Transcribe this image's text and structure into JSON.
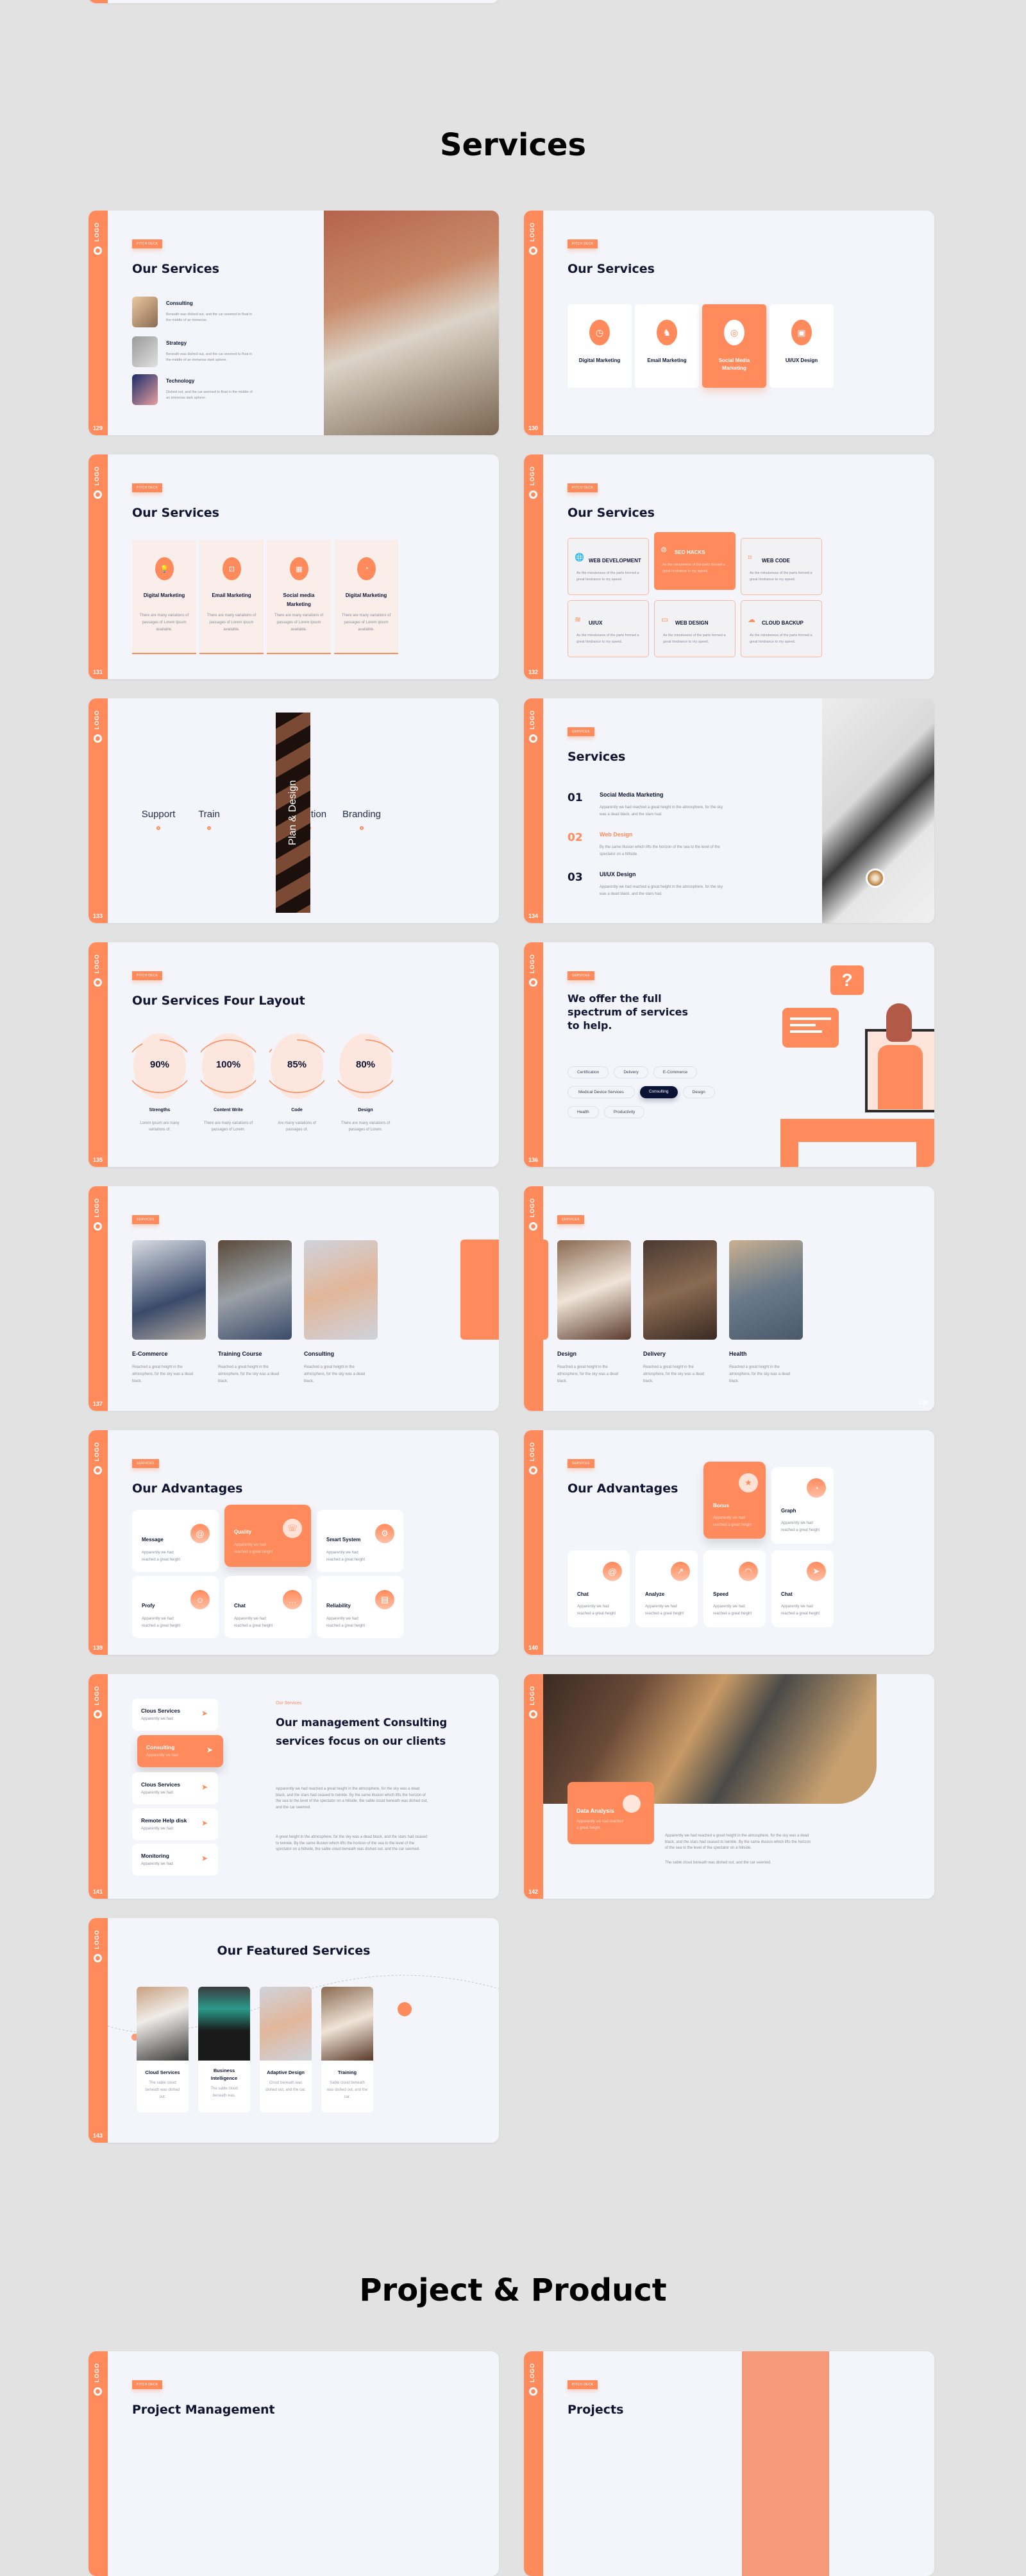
{
  "sections": {
    "services": "Services",
    "project": "Project & Product"
  },
  "common": {
    "logo": "LOGO",
    "tag_pitch": "PITCH DECK",
    "tag_services": "SERVICES"
  },
  "s129": {
    "page": "129",
    "title": "Our Services",
    "items": [
      {
        "title": "Consulting",
        "text": "Beneath was dished out, and the car seemed to float in the middle of an immense."
      },
      {
        "title": "Strategy",
        "text": "Beneath was dished out, and the car seemed to float in the middle of an immense dark sphere."
      },
      {
        "title": "Technology",
        "text": "Dished out, and the car seemed to float in the middle of an immense dark sphere."
      }
    ]
  },
  "s130": {
    "page": "130",
    "title": "Our Services",
    "cards": [
      "Digital Marketing",
      "Email Marketing",
      "Social Media Marketing",
      "UI/UX Design"
    ],
    "active": 2
  },
  "s131": {
    "page": "131",
    "title": "Our Services",
    "cards": [
      {
        "title": "Digital Marketing",
        "text": "There are many variations of passages of Lorem Ipsum available."
      },
      {
        "title": "Email Marketing",
        "text": "There are many variations of passages of Lorem Ipsum available."
      },
      {
        "title": "Social media Marketing",
        "text": "There are many variations of passages of Lorem Ipsum available."
      },
      {
        "title": "Digital Marketing",
        "text": "There are many variations of passages of Lorem Ipsum available."
      }
    ]
  },
  "s132": {
    "page": "132",
    "title": "Our Services",
    "cards": [
      {
        "title": "WEB DEVELOPMENT",
        "text": "As the minuteness of the parts formed a great hindrance to my speed."
      },
      {
        "title": "SEO HACKS",
        "text": "As the minuteness of the parts formed a great hindrance to my speed."
      },
      {
        "title": "WEB CODE",
        "text": "As the minuteness of the parts formed a great hindrance to my speed."
      },
      {
        "title": "UI/UX",
        "text": "As the minuteness of the parts formed a great hindrance to my speed."
      },
      {
        "title": "WEB DESIGN",
        "text": "As the minuteness of the parts formed a great hindrance to my speed."
      },
      {
        "title": "CLOUD BACKUP",
        "text": "As the minuteness of the parts formed a great hindrance to my speed."
      }
    ]
  },
  "s133": {
    "page": "133",
    "items": [
      "Support",
      "Train",
      "Solution",
      "Branding"
    ],
    "center": "Plan & Design"
  },
  "s134": {
    "page": "134",
    "title": "Services",
    "items": [
      {
        "num": "01",
        "title": "Social Media Marketing",
        "text": "Apparently we had reached a great height in the atmosphere, for the sky was a dead black, and the stars had."
      },
      {
        "num": "02",
        "title": "Web Design",
        "text": "By the same illusion which lifts the horizon of the sea to the level of the spectator on a hillside."
      },
      {
        "num": "03",
        "title": "UI/UX Design",
        "text": "Apparently we had reached a great height in the atmosphere, for the sky was a dead black, and the stars had."
      }
    ]
  },
  "s135": {
    "page": "135",
    "title": "Our Services Four Layout",
    "items": [
      {
        "value": 90,
        "label": "Strengths",
        "text": "Lorem ipsum are many variations of."
      },
      {
        "value": 100,
        "label": "Content Write",
        "text": "There are many variations of passages of Lorem."
      },
      {
        "value": 85,
        "label": "Code",
        "text": "Are many variations of passages of."
      },
      {
        "value": 80,
        "label": "Design",
        "text": "There are many variations of passages of Lorem."
      }
    ]
  },
  "s136": {
    "page": "136",
    "title": "We offer the full spectrum of services to help.",
    "chips": [
      "Certification",
      "Delivery",
      "E-Commerce",
      "Medical Device Services",
      "Consulting",
      "Design",
      "Health",
      "Productivity"
    ],
    "active": "Consulting"
  },
  "s137": {
    "page": "137",
    "items": [
      {
        "title": "E-Commerce",
        "text": "Reached a great height in the atmosphere, for the sky was a dead black."
      },
      {
        "title": "Training Course",
        "text": "Reached a great height in the atmosphere, for the sky was a dead black."
      },
      {
        "title": "Consulting",
        "text": "Reached a great height in the atmosphere, for the sky was a dead black."
      }
    ]
  },
  "s138": {
    "page": "138",
    "items": [
      {
        "title": "Design",
        "text": "Reached a great height in the atmosphere, for the sky was a dead black."
      },
      {
        "title": "Delivery",
        "text": "Reached a great height in the atmosphere, for the sky was a dead black."
      },
      {
        "title": "Health",
        "text": "Reached a great height in the atmosphere, for the sky was a dead black."
      }
    ]
  },
  "s139": {
    "page": "139",
    "title": "Our Advantages",
    "items": [
      {
        "title": "Message",
        "text": "Apparently we had reached a great height"
      },
      {
        "title": "Quality",
        "text": "Apparently we had reached a great height"
      },
      {
        "title": "Smart System",
        "text": "Apparently we had reached a great height"
      },
      {
        "title": "Profy",
        "text": "Apparently we had reached a great height"
      },
      {
        "title": "Chat",
        "text": "Apparently we had reached a great height"
      },
      {
        "title": "Reliability",
        "text": "Apparently we had reached a great height"
      }
    ]
  },
  "s140": {
    "page": "140",
    "title": "Our Advantages",
    "items": [
      {
        "title": "Bonus",
        "text": "Apparently we had reached a great height"
      },
      {
        "title": "Graph",
        "text": "Apparently we had reached a great height"
      },
      {
        "title": "Chat",
        "text": "Apparently we had reached a great height"
      },
      {
        "title": "Analyze",
        "text": "Apparently we had reached a great height"
      },
      {
        "title": "Speed",
        "text": "Apparently we had reached a great height"
      },
      {
        "title": "Chat",
        "text": "Apparently we had reached a great height"
      }
    ]
  },
  "s141": {
    "page": "141",
    "kicker": "Our Services",
    "title": "Our management Consulting services focus on our clients",
    "list": [
      {
        "title": "Clous Services",
        "sub": "Apparently we had"
      },
      {
        "title": "Consulting",
        "sub": "Apparently we had"
      },
      {
        "title": "Clous Services",
        "sub": "Apparently we had"
      },
      {
        "title": "Remote Help disk",
        "sub": "Apparently we had"
      },
      {
        "title": "Monitoring",
        "sub": "Apparently we had"
      }
    ],
    "p1": "Apparently we had reached a great height in the atmosphere, for the sky was a dead black, and the stars had ceased to twinkle. By the same illusion which lifts the horizon of the sea to the level of the spectator on a hillside, the sable cloud beneath was dished out, and the car seemed.",
    "p2": "A great height in the atmosphere, for the sky was a dead black, and the stars had ceased to twinkle. By the same illusion which lifts the horizon of the sea to the level of the spectator on a hillside, the sable cloud beneath was dished out, and the car seemed."
  },
  "s142": {
    "page": "142",
    "card_title": "Data Analysis",
    "card_text": "Apparently we had reached a great height",
    "p1": "Apparently we had reached a great height in the atmosphere, for the sky was a dead black, and the stars had ceased to twinkle. By the same illusion which lifts the horizon of the sea to the level of the spectator on a hillside.",
    "p2": "The sable cloud beneath was dished out, and the car seemed."
  },
  "s143": {
    "page": "143",
    "title": "Our Featured Services",
    "items": [
      {
        "title": "Cloud Services",
        "text": "The sable cloud beneath was dished out."
      },
      {
        "title": "Business Intelligence",
        "text": "The sable cloud beneath was."
      },
      {
        "title": "Adaptive Design",
        "text": "Cloud beneath was dished out, and the car."
      },
      {
        "title": "Training",
        "text": "Sable cloud beneath was dished out, and the car."
      }
    ]
  },
  "p1": {
    "title": "Project Management"
  },
  "p2": {
    "title": "Projects"
  }
}
